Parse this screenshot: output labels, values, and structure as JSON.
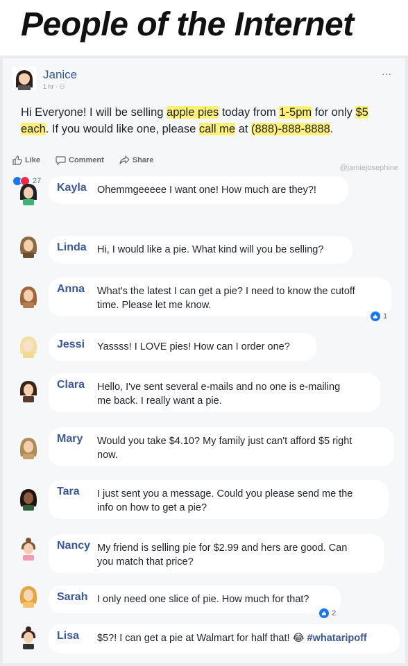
{
  "banner": {
    "title": "People of the Internet"
  },
  "post": {
    "author": "Janice",
    "meta": "1 hr · ⚇",
    "more": "···",
    "text_parts": {
      "a": "Hi Everyone! I will be selling ",
      "b": "apple pies",
      "c": " today from ",
      "d": "1-5pm",
      "e": " for only ",
      "f": "$5 each",
      "g": ". If you would like one, please ",
      "h": "call me",
      "i": " at ",
      "j": "(888)-888-8888",
      "k": "."
    },
    "actions": {
      "like": "Like",
      "comment": "Comment",
      "share": "Share"
    },
    "watermark": "@jamiejosephine",
    "reaction_count": "27",
    "highlight_color": "#fff176",
    "link_color": "#385898"
  },
  "comments": [
    {
      "name": "Kayla",
      "text": "Ohemmgeeeee I want one! How much are they?!"
    },
    {
      "name": "Linda",
      "text": "Hi, I would like a pie. What kind will you be selling?"
    },
    {
      "name": "Anna",
      "line1": "What's the latest I can get a pie? I need to know the cutoff",
      "line2": "time. Please let me know.",
      "reactions": "1"
    },
    {
      "name": "Jessi",
      "text": "Yassss! I LOVE pies! How can I order one?"
    },
    {
      "name": "Clara",
      "line1": "Hello, I've sent several e-mails and no one is e-mailing",
      "line2": "me back. I really want a pie."
    },
    {
      "name": "Mary",
      "line1": "Would you take $4.10? My family just can't afford $5 right",
      "line2": "now."
    },
    {
      "name": "Tara",
      "line1": "I just sent you a message. Could you please send me the",
      "line2": "info on how to get a pie?"
    },
    {
      "name": "Nancy",
      "line1": "My friend is selling pie for $2.99 and hers are good. Can",
      "line2": "you match that price?"
    },
    {
      "name": "Sarah",
      "text": "I only need one slice of pie. How much for that?",
      "reactions": "2"
    },
    {
      "name": "Lisa",
      "text": "$5?! I can get a pie at Walmart for half that! ",
      "emoji": "😂",
      "hashtag": "#whataripoff"
    }
  ]
}
